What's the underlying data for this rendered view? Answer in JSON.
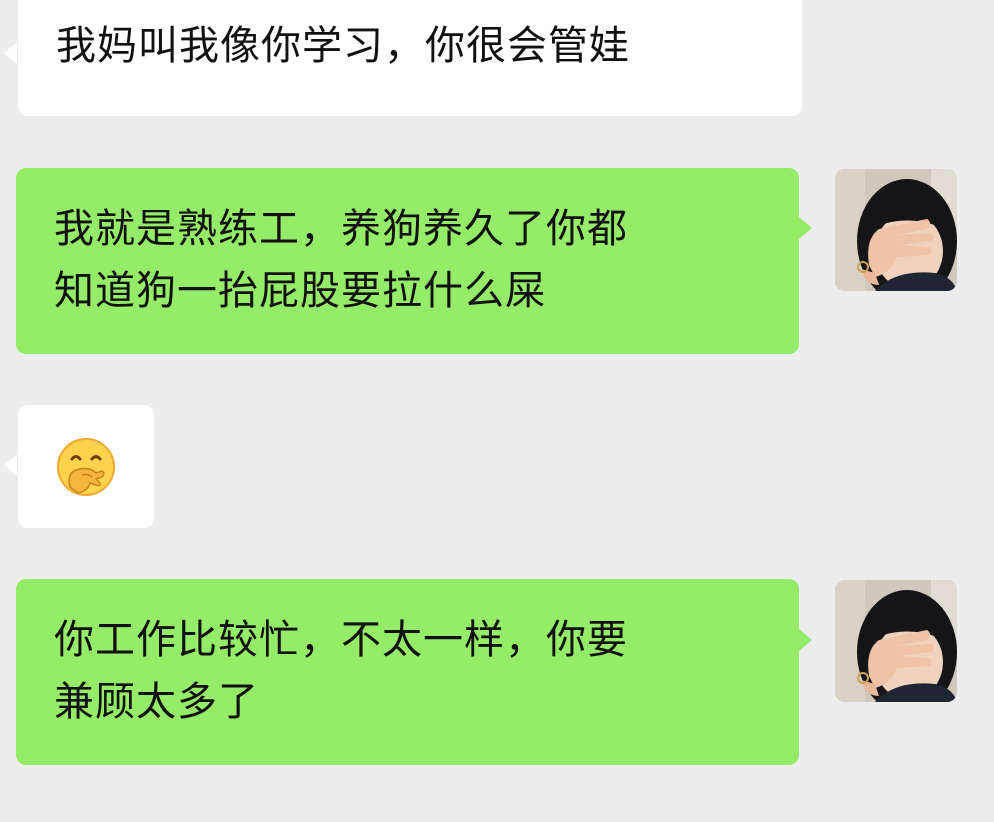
{
  "messages": [
    {
      "side": "left",
      "text": "我妈叫我像你学习，你很会管娃"
    },
    {
      "side": "right",
      "lines": [
        "我就是熟练工，养狗养久了你都",
        "知道狗一抬屁股要拉什么屎"
      ]
    },
    {
      "side": "left",
      "emoji": "hand-over-mouth-emoji"
    },
    {
      "side": "right",
      "lines": [
        "你工作比较忙，不太一样，你要",
        "兼顾太多了"
      ]
    }
  ],
  "colors": {
    "background": "#ededed",
    "incoming_bubble": "#ffffff",
    "outgoing_bubble": "#95ec69",
    "text": "#111111"
  }
}
